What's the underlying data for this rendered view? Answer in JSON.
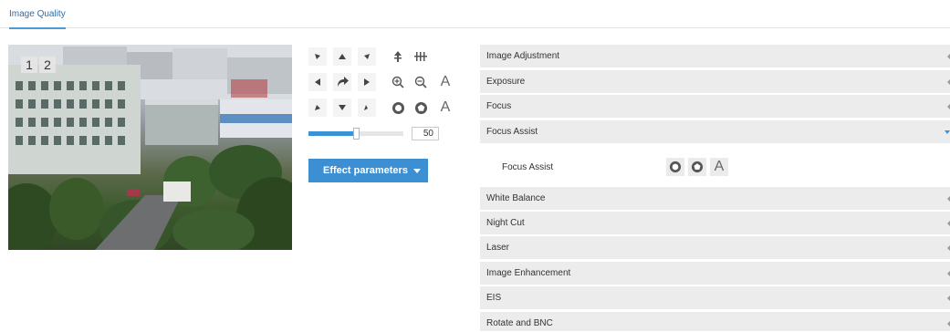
{
  "tabs": [
    {
      "label": "Image Quality",
      "active": true
    }
  ],
  "preview": {
    "channel_buttons": [
      "1",
      "2"
    ]
  },
  "ptz": {
    "rows": [
      [
        "arrow-up-left-icon",
        "arrow-up-icon",
        "arrow-up-right-icon",
        "wiper-icon",
        "light-icon"
      ],
      [
        "arrow-left-icon",
        "auto-rotate-icon",
        "arrow-right-icon",
        "zoom-in-icon",
        "zoom-out-icon",
        "auto-zoom-icon"
      ],
      [
        "arrow-down-left-icon",
        "arrow-down-icon",
        "arrow-down-right-icon",
        "focus-near-icon",
        "focus-far-icon",
        "auto-focus-icon"
      ]
    ],
    "auto_letter": "A",
    "speed_value": "50",
    "speed_fraction": 0.5
  },
  "effect_button": {
    "label": "Effect parameters"
  },
  "accordion": [
    {
      "label": "Image Adjustment",
      "expanded": false
    },
    {
      "label": "Exposure",
      "expanded": false
    },
    {
      "label": "Focus",
      "expanded": false
    },
    {
      "label": "Focus Assist",
      "expanded": true
    },
    {
      "label": "White Balance",
      "expanded": false
    },
    {
      "label": "Night Cut",
      "expanded": false
    },
    {
      "label": "Laser",
      "expanded": false
    },
    {
      "label": "Image Enhancement",
      "expanded": false
    },
    {
      "label": "EIS",
      "expanded": false
    },
    {
      "label": "Rotate and BNC",
      "expanded": false
    }
  ],
  "focus_assist": {
    "label": "Focus Assist",
    "auto_letter": "A"
  },
  "colors": {
    "accent": "#3d8fd4",
    "tab_text": "#2d6ea8",
    "section_bg": "#ececec"
  }
}
